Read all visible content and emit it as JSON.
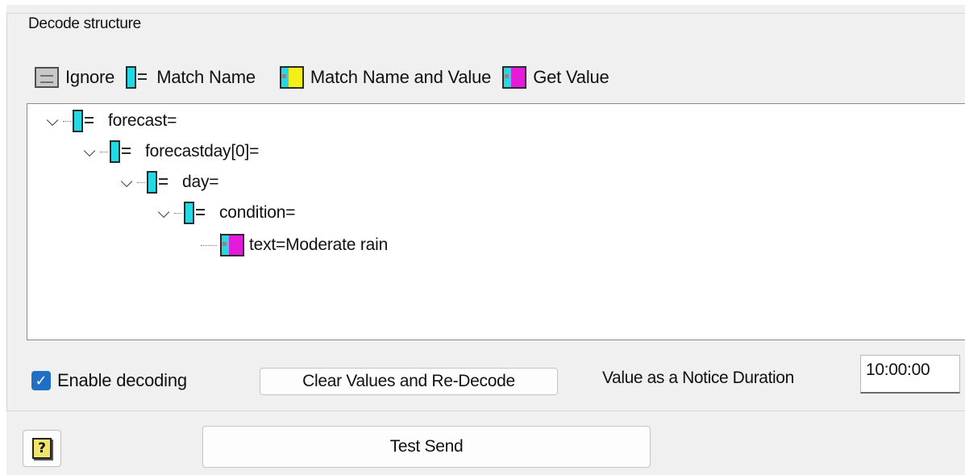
{
  "group": {
    "title": "Decode structure"
  },
  "legend": [
    {
      "label": "Ignore",
      "icon": "ignore-icon"
    },
    {
      "label": "Match Name",
      "icon": "match-name-icon"
    },
    {
      "label": "Match Name and Value",
      "icon": "match-name-value-icon"
    },
    {
      "label": "Get Value",
      "icon": "get-value-icon"
    }
  ],
  "tree": [
    {
      "label": "forecast=",
      "expanded": true,
      "icon": "match-name-icon"
    },
    {
      "label": "forecastday[0]=",
      "expanded": true,
      "icon": "match-name-icon"
    },
    {
      "label": "day=",
      "expanded": true,
      "icon": "match-name-icon"
    },
    {
      "label": "condition=",
      "expanded": true,
      "icon": "match-name-icon"
    },
    {
      "label": "text=Moderate rain",
      "expanded": false,
      "icon": "get-value-icon"
    }
  ],
  "options": {
    "enable_decoding_label": "Enable decoding",
    "enable_decoding_checked": true,
    "clear_button_label": "Clear Values and Re-Decode",
    "duration_label": "Value as a Notice Duration",
    "duration_value": "10:00:00"
  },
  "footer": {
    "test_send_label": "Test Send",
    "help_icon_glyph": "?"
  },
  "colors": {
    "cyan": "#25d9e4",
    "yellow": "#f4ef1a",
    "magenta": "#e41cd9",
    "checkbox": "#1f6fc5"
  }
}
